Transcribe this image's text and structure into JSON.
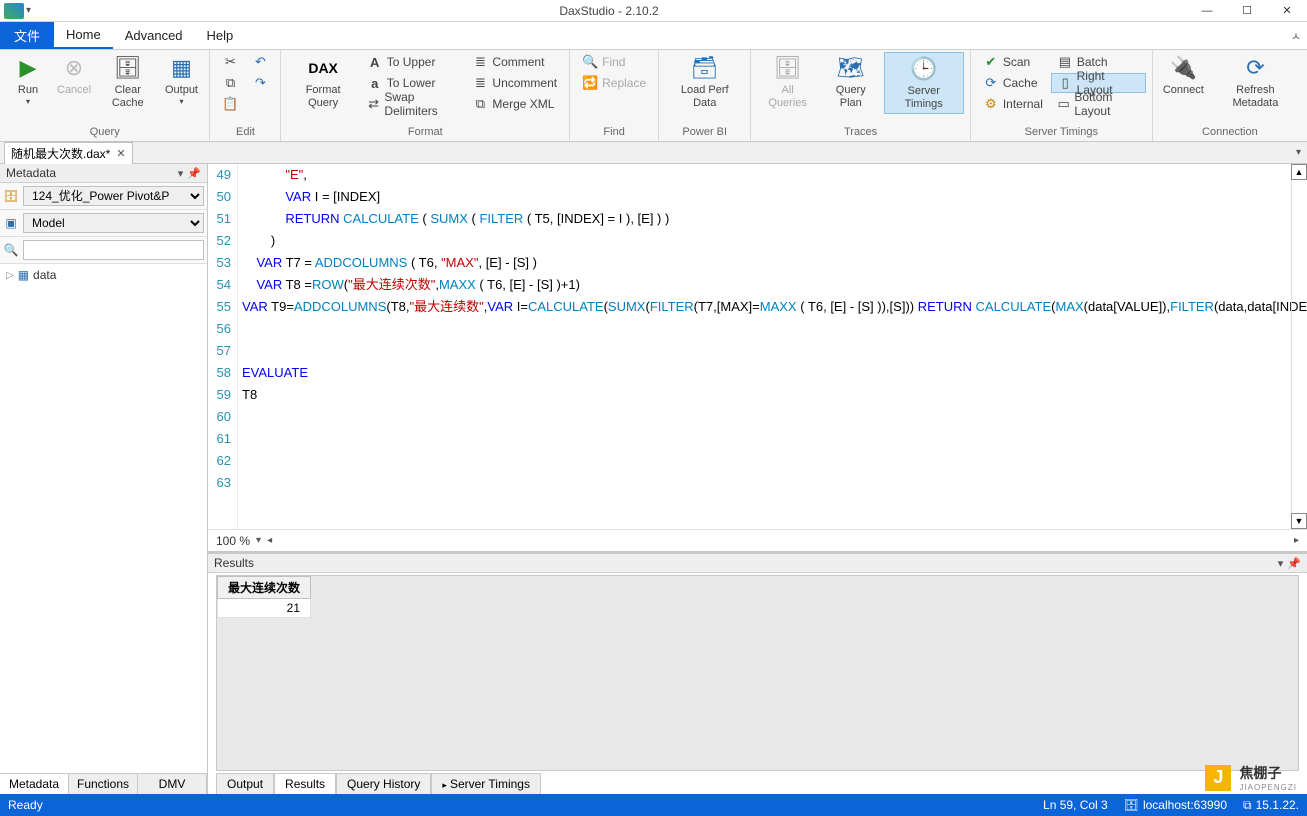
{
  "window": {
    "title": "DaxStudio - 2.10.2"
  },
  "menu": {
    "file": "文件",
    "tabs": [
      "Home",
      "Advanced",
      "Help"
    ],
    "active": 0
  },
  "ribbon": {
    "query": {
      "label": "Query",
      "run": "Run",
      "cancel": "Cancel",
      "clear": "Clear\nCache",
      "output": "Output"
    },
    "edit": {
      "label": "Edit"
    },
    "fmt": {
      "label": "Format",
      "format_query": "Format\nQuery",
      "upper": "To Upper",
      "lower": "To Lower",
      "swap": "Swap Delimiters",
      "comment": "Comment",
      "uncomment": "Uncomment",
      "mergexml": "Merge XML"
    },
    "find": {
      "label": "Find",
      "find": "Find",
      "replace": "Replace"
    },
    "powerbi": {
      "label": "Power BI",
      "load": "Load Perf\nData"
    },
    "traces": {
      "label": "Traces",
      "allq": "All\nQueries",
      "qplan": "Query\nPlan",
      "stimings": "Server\nTimings"
    },
    "st": {
      "label": "Server Timings",
      "scan": "Scan",
      "cache": "Cache",
      "internal": "Internal",
      "batch": "Batch",
      "rlayout": "Right Layout",
      "blayout": "Bottom Layout"
    },
    "conn": {
      "label": "Connection",
      "connect": "Connect",
      "refresh": "Refresh\nMetadata"
    }
  },
  "doc": {
    "tab": "随机最大次数.dax*"
  },
  "metadata": {
    "title": "Metadata",
    "db": "124_优化_Power Pivot&P",
    "model": "Model",
    "tree": [
      "data"
    ],
    "tabs": [
      "Metadata",
      "Functions",
      "DMV"
    ],
    "active_tab": 0
  },
  "editor": {
    "zoom": "100 %",
    "lines": [
      {
        "n": 49,
        "html": "            <span class='str'>\"E\"</span>,"
      },
      {
        "n": 50,
        "html": "            <span class='kw'>VAR</span> I = [INDEX]"
      },
      {
        "n": 51,
        "html": "            <span class='kw'>RETURN</span> <span class='fn'>CALCULATE</span> ( <span class='fn'>SUMX</span> ( <span class='fn'>FILTER</span> ( T5, [INDEX] = I ), [E] ) )"
      },
      {
        "n": 52,
        "html": "        )"
      },
      {
        "n": 53,
        "html": "    <span class='kw'>VAR</span> T7 = <span class='fn'>ADDCOLUMNS</span> ( T6, <span class='str'>\"MAX\"</span>, [E] - [S] )"
      },
      {
        "n": 54,
        "html": "    <span class='kw'>VAR</span> T8 =<span class='fn'>ROW</span>(<span class='str'>\"最大连续次数\"</span>,<span class='fn'>MAXX</span> ( T6, [E] - [S] )+1)"
      },
      {
        "n": 55,
        "html": "<span class='kw'>VAR</span> T9=<span class='fn'>ADDCOLUMNS</span>(T8,<span class='str'>\"最大连续数\"</span>,<span class='kw'>VAR</span> I=<span class='fn'>CALCULATE</span>(<span class='fn'>SUMX</span>(<span class='fn'>FILTER</span>(T7,[MAX]=<span class='fn'>MAXX</span> ( T6, [E] - [S] )),[S])) <span class='kw'>RETURN</span> <span class='fn'>CALCULATE</span>(<span class='fn'>MAX</span>(data[VALUE]),<span class='fn'>FILTER</span>(data,data[INDEX]=I) ))"
      },
      {
        "n": 56,
        "html": ""
      },
      {
        "n": 57,
        "html": ""
      },
      {
        "n": 58,
        "html": "<span class='kw'>EVALUATE</span>"
      },
      {
        "n": 59,
        "html": "T8"
      },
      {
        "n": 60,
        "html": ""
      },
      {
        "n": 61,
        "html": ""
      },
      {
        "n": 62,
        "html": ""
      },
      {
        "n": 63,
        "html": ""
      }
    ]
  },
  "results": {
    "title": "Results",
    "columns": [
      "最大连续次数"
    ],
    "rows": [
      [
        "21"
      ]
    ],
    "tabs": [
      "Output",
      "Results",
      "Query History",
      "Server Timings"
    ],
    "active_tab": 1
  },
  "status": {
    "ready": "Ready",
    "pos": "Ln 59, Col 3",
    "server": "localhost:63990",
    "ver": "15.1.22."
  },
  "watermark": {
    "text": "焦棚子",
    "sub": "JIAOPENGZI"
  }
}
